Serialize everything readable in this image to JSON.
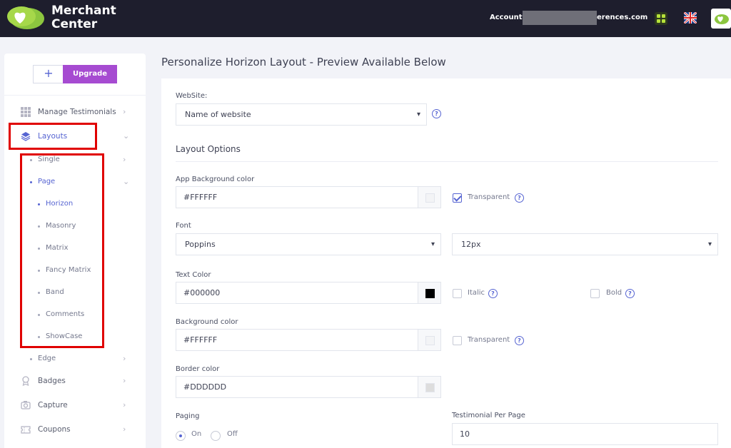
{
  "header": {
    "brand_line1": "Merchant",
    "brand_line2": "Center",
    "account_label": "Account:",
    "account_domain_visible": "erences.com",
    "icons": [
      "logo-hearts-icon",
      "apps-grid-icon",
      "uk-flag-icon",
      "user-avatar-icon"
    ]
  },
  "sidebar": {
    "plus_label": "+",
    "upgrade_label": "Upgrade",
    "items": [
      {
        "label": "Manage Testimonials",
        "icon": "grid-icon"
      },
      {
        "label": "Layouts",
        "icon": "layers-icon"
      },
      {
        "label": "Badges",
        "icon": "badge-icon"
      },
      {
        "label": "Capture",
        "icon": "capture-icon"
      },
      {
        "label": "Coupons",
        "icon": "coupon-icon"
      }
    ],
    "layouts_sub": [
      {
        "label": "Single"
      },
      {
        "label": "Page"
      },
      {
        "label": "Edge"
      }
    ],
    "page_sub": [
      {
        "label": "Horizon"
      },
      {
        "label": "Masonry"
      },
      {
        "label": "Matrix"
      },
      {
        "label": "Fancy Matrix"
      },
      {
        "label": "Band"
      },
      {
        "label": "Comments"
      },
      {
        "label": "ShowCase"
      }
    ],
    "accent_color": "#5664d2",
    "highlight_color": "#e00000"
  },
  "main": {
    "title": "Personalize Horizon Layout - Preview Available Below",
    "website_label": "WebSite:",
    "website_value": "Name of website",
    "section_title": "Layout Options",
    "app_bg_label": "App Background color",
    "app_bg_value": "#FFFFFF",
    "transparent_label": "Transparent",
    "font_label": "Font",
    "font_value": "Poppins",
    "font_size_value": "12px",
    "text_color_label": "Text Color",
    "text_color_value": "#000000",
    "italic_label": "Italic",
    "bold_label": "Bold",
    "bg_color_label": "Background color",
    "bg_color_value": "#FFFFFF",
    "border_color_label": "Border color",
    "border_color_value": "#DDDDDD",
    "paging_label": "Paging",
    "paging_on": "On",
    "paging_off": "Off",
    "per_page_label": "Testimonial Per Page",
    "per_page_value": "10",
    "help_glyph": "?"
  }
}
